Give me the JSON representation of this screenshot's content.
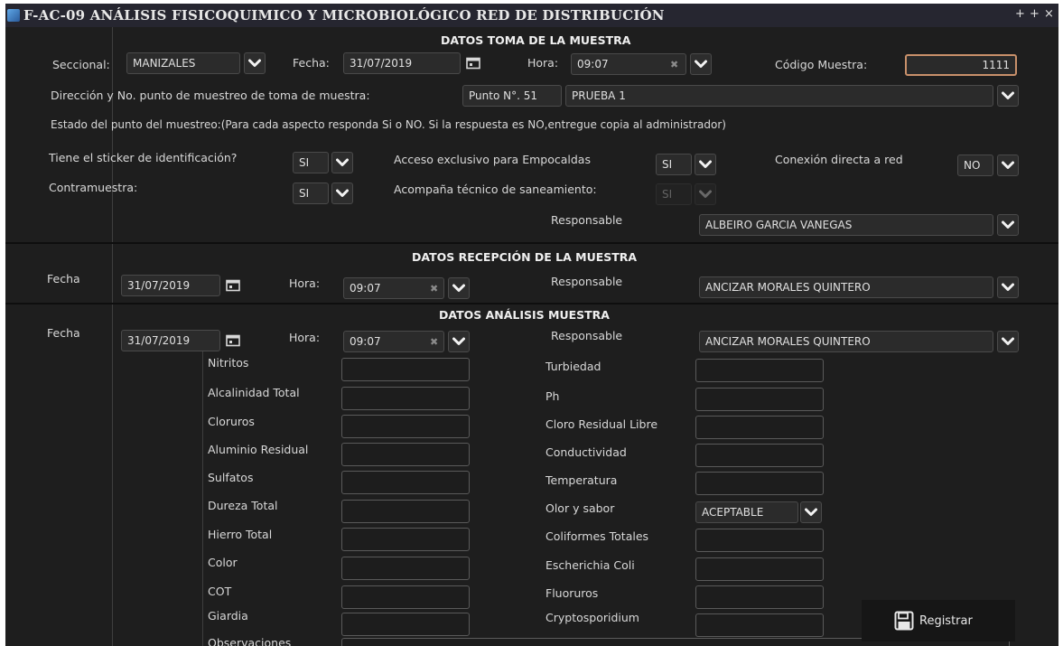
{
  "window": {
    "title": "F-AC-09 ANÁLISIS FISICOQUIMICO Y MICROBIOLÓGICO RED DE DISTRIBUCIÓN",
    "controls": [
      "+",
      "+",
      "×"
    ]
  },
  "toma": {
    "header": "DATOS TOMA DE LA MUESTRA",
    "seccional_label": "Seccional:",
    "seccional_value": "MANIZALES",
    "fecha_label": "Fecha:",
    "fecha_value": "31/07/2019",
    "hora_label": "Hora:",
    "hora_value": "09:07",
    "codigo_label": "Código Muestra:",
    "codigo_value": "1111",
    "direccion_label": "Dirección y No. punto de muestreo de toma de muestra:",
    "punto_value": "Punto N°. 51",
    "prueba_value": "PRUEBA 1",
    "estado_text": "Estado del punto del muestreo:(Para cada aspecto responda Si o NO. Si la respuesta es NO,entregue copia al administrador)",
    "sticker_label": "Tiene el sticker de identificación?",
    "sticker_value": "SI",
    "acceso_label": "Acceso exclusivo para Empocaldas",
    "acceso_value": "SI",
    "conexion_label": "Conexión directa a red",
    "conexion_value": "NO",
    "contramuestra_label": "Contramuestra:",
    "contramuestra_value": "SI",
    "acompana_label": "Acompaña técnico de saneamiento:",
    "acompana_value": "SI",
    "responsable_label": "Responsable",
    "responsable_value": "ALBEIRO GARCIA VANEGAS"
  },
  "recepcion": {
    "header": "DATOS RECEPCIÓN DE LA MUESTRA",
    "fecha_label": "Fecha",
    "fecha_value": "31/07/2019",
    "hora_label": "Hora:",
    "hora_value": "09:07",
    "responsable_label": "Responsable",
    "responsable_value": "ANCIZAR MORALES QUINTERO"
  },
  "analisis": {
    "header": "DATOS ANÁLISIS MUESTRA",
    "fecha_label": "Fecha",
    "fecha_value": "31/07/2019",
    "hora_label": "Hora:",
    "hora_value": "09:07",
    "responsable_label": "Responsable",
    "responsable_value": "ANCIZAR MORALES QUINTERO",
    "left_params": [
      "Nitritos",
      "Alcalinidad Total",
      "Cloruros",
      "Aluminio Residual",
      "Sulfatos",
      "Dureza Total",
      "Hierro Total",
      "Color",
      "COT",
      "Giardia"
    ],
    "right_params": [
      "Turbiedad",
      "Ph",
      "Cloro Residual Libre",
      "Conductividad",
      "Temperatura",
      "Olor y sabor",
      "Coliformes Totales",
      "Escherichia Coli",
      "Fluoruros",
      "Cryptosporidium"
    ],
    "olor_value": "ACEPTABLE",
    "observaciones_label": "Observaciones",
    "registrar_label": "Registrar"
  },
  "icons": {
    "dropdown": "chevron-down-icon",
    "calendar": "calendar-icon",
    "clear": "clear-x-icon",
    "save": "floppy-disk-icon"
  }
}
